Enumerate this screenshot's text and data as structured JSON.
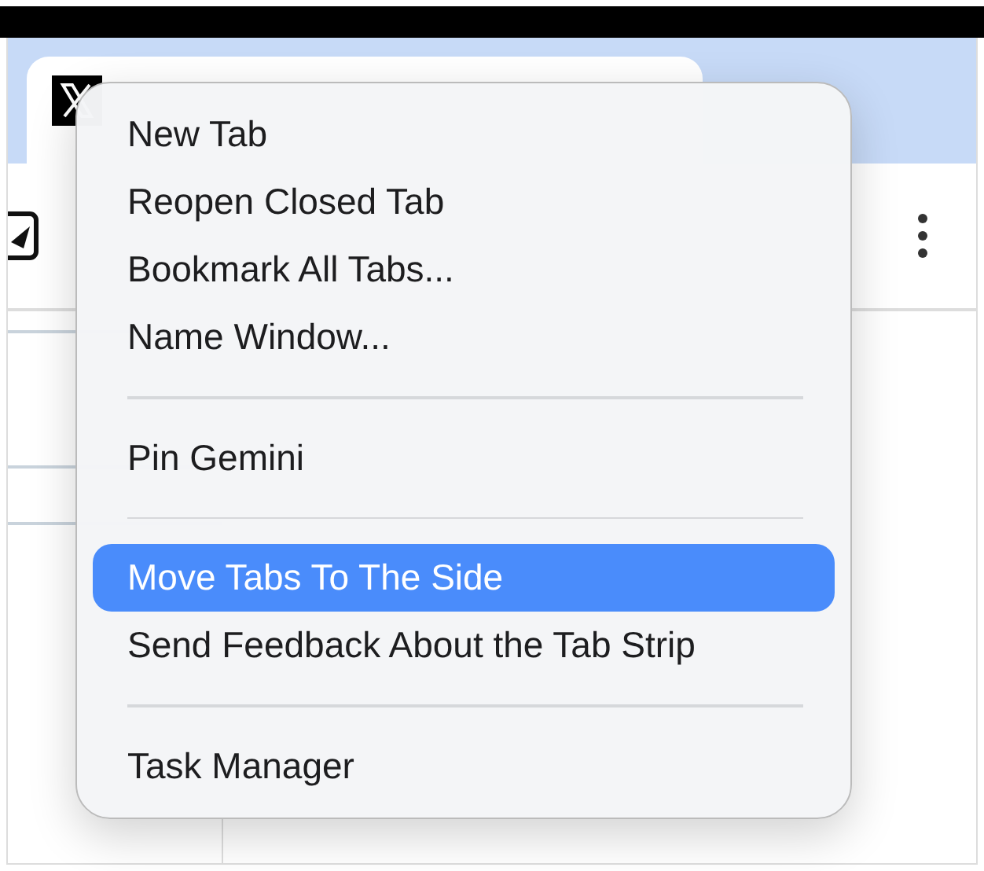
{
  "context_menu": {
    "items": [
      {
        "kind": "item",
        "label": "New Tab",
        "selected": false
      },
      {
        "kind": "item",
        "label": "Reopen Closed Tab",
        "selected": false
      },
      {
        "kind": "item",
        "label": "Bookmark All Tabs...",
        "selected": false
      },
      {
        "kind": "item",
        "label": "Name Window...",
        "selected": false
      },
      {
        "kind": "separator"
      },
      {
        "kind": "item",
        "label": "Pin Gemini",
        "selected": false
      },
      {
        "kind": "separator"
      },
      {
        "kind": "item",
        "label": "Move Tabs To The Side",
        "selected": true
      },
      {
        "kind": "item",
        "label": "Send Feedback About the Tab Strip",
        "selected": false
      },
      {
        "kind": "separator"
      },
      {
        "kind": "item",
        "label": "Task Manager",
        "selected": false
      }
    ]
  }
}
